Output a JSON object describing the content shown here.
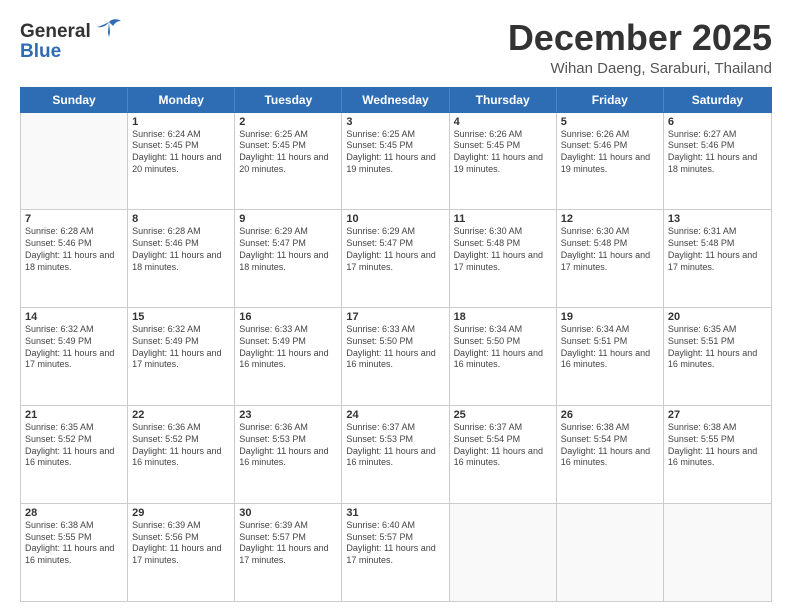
{
  "header": {
    "logo_general": "General",
    "logo_blue": "Blue",
    "month_title": "December 2025",
    "location": "Wihan Daeng, Saraburi, Thailand"
  },
  "days_of_week": [
    "Sunday",
    "Monday",
    "Tuesday",
    "Wednesday",
    "Thursday",
    "Friday",
    "Saturday"
  ],
  "weeks": [
    [
      {
        "day": "",
        "sunrise": "",
        "sunset": "",
        "daylight": ""
      },
      {
        "day": "1",
        "sunrise": "Sunrise: 6:24 AM",
        "sunset": "Sunset: 5:45 PM",
        "daylight": "Daylight: 11 hours and 20 minutes."
      },
      {
        "day": "2",
        "sunrise": "Sunrise: 6:25 AM",
        "sunset": "Sunset: 5:45 PM",
        "daylight": "Daylight: 11 hours and 20 minutes."
      },
      {
        "day": "3",
        "sunrise": "Sunrise: 6:25 AM",
        "sunset": "Sunset: 5:45 PM",
        "daylight": "Daylight: 11 hours and 19 minutes."
      },
      {
        "day": "4",
        "sunrise": "Sunrise: 6:26 AM",
        "sunset": "Sunset: 5:45 PM",
        "daylight": "Daylight: 11 hours and 19 minutes."
      },
      {
        "day": "5",
        "sunrise": "Sunrise: 6:26 AM",
        "sunset": "Sunset: 5:46 PM",
        "daylight": "Daylight: 11 hours and 19 minutes."
      },
      {
        "day": "6",
        "sunrise": "Sunrise: 6:27 AM",
        "sunset": "Sunset: 5:46 PM",
        "daylight": "Daylight: 11 hours and 18 minutes."
      }
    ],
    [
      {
        "day": "7",
        "sunrise": "Sunrise: 6:28 AM",
        "sunset": "Sunset: 5:46 PM",
        "daylight": "Daylight: 11 hours and 18 minutes."
      },
      {
        "day": "8",
        "sunrise": "Sunrise: 6:28 AM",
        "sunset": "Sunset: 5:46 PM",
        "daylight": "Daylight: 11 hours and 18 minutes."
      },
      {
        "day": "9",
        "sunrise": "Sunrise: 6:29 AM",
        "sunset": "Sunset: 5:47 PM",
        "daylight": "Daylight: 11 hours and 18 minutes."
      },
      {
        "day": "10",
        "sunrise": "Sunrise: 6:29 AM",
        "sunset": "Sunset: 5:47 PM",
        "daylight": "Daylight: 11 hours and 17 minutes."
      },
      {
        "day": "11",
        "sunrise": "Sunrise: 6:30 AM",
        "sunset": "Sunset: 5:48 PM",
        "daylight": "Daylight: 11 hours and 17 minutes."
      },
      {
        "day": "12",
        "sunrise": "Sunrise: 6:30 AM",
        "sunset": "Sunset: 5:48 PM",
        "daylight": "Daylight: 11 hours and 17 minutes."
      },
      {
        "day": "13",
        "sunrise": "Sunrise: 6:31 AM",
        "sunset": "Sunset: 5:48 PM",
        "daylight": "Daylight: 11 hours and 17 minutes."
      }
    ],
    [
      {
        "day": "14",
        "sunrise": "Sunrise: 6:32 AM",
        "sunset": "Sunset: 5:49 PM",
        "daylight": "Daylight: 11 hours and 17 minutes."
      },
      {
        "day": "15",
        "sunrise": "Sunrise: 6:32 AM",
        "sunset": "Sunset: 5:49 PM",
        "daylight": "Daylight: 11 hours and 17 minutes."
      },
      {
        "day": "16",
        "sunrise": "Sunrise: 6:33 AM",
        "sunset": "Sunset: 5:49 PM",
        "daylight": "Daylight: 11 hours and 16 minutes."
      },
      {
        "day": "17",
        "sunrise": "Sunrise: 6:33 AM",
        "sunset": "Sunset: 5:50 PM",
        "daylight": "Daylight: 11 hours and 16 minutes."
      },
      {
        "day": "18",
        "sunrise": "Sunrise: 6:34 AM",
        "sunset": "Sunset: 5:50 PM",
        "daylight": "Daylight: 11 hours and 16 minutes."
      },
      {
        "day": "19",
        "sunrise": "Sunrise: 6:34 AM",
        "sunset": "Sunset: 5:51 PM",
        "daylight": "Daylight: 11 hours and 16 minutes."
      },
      {
        "day": "20",
        "sunrise": "Sunrise: 6:35 AM",
        "sunset": "Sunset: 5:51 PM",
        "daylight": "Daylight: 11 hours and 16 minutes."
      }
    ],
    [
      {
        "day": "21",
        "sunrise": "Sunrise: 6:35 AM",
        "sunset": "Sunset: 5:52 PM",
        "daylight": "Daylight: 11 hours and 16 minutes."
      },
      {
        "day": "22",
        "sunrise": "Sunrise: 6:36 AM",
        "sunset": "Sunset: 5:52 PM",
        "daylight": "Daylight: 11 hours and 16 minutes."
      },
      {
        "day": "23",
        "sunrise": "Sunrise: 6:36 AM",
        "sunset": "Sunset: 5:53 PM",
        "daylight": "Daylight: 11 hours and 16 minutes."
      },
      {
        "day": "24",
        "sunrise": "Sunrise: 6:37 AM",
        "sunset": "Sunset: 5:53 PM",
        "daylight": "Daylight: 11 hours and 16 minutes."
      },
      {
        "day": "25",
        "sunrise": "Sunrise: 6:37 AM",
        "sunset": "Sunset: 5:54 PM",
        "daylight": "Daylight: 11 hours and 16 minutes."
      },
      {
        "day": "26",
        "sunrise": "Sunrise: 6:38 AM",
        "sunset": "Sunset: 5:54 PM",
        "daylight": "Daylight: 11 hours and 16 minutes."
      },
      {
        "day": "27",
        "sunrise": "Sunrise: 6:38 AM",
        "sunset": "Sunset: 5:55 PM",
        "daylight": "Daylight: 11 hours and 16 minutes."
      }
    ],
    [
      {
        "day": "28",
        "sunrise": "Sunrise: 6:38 AM",
        "sunset": "Sunset: 5:55 PM",
        "daylight": "Daylight: 11 hours and 16 minutes."
      },
      {
        "day": "29",
        "sunrise": "Sunrise: 6:39 AM",
        "sunset": "Sunset: 5:56 PM",
        "daylight": "Daylight: 11 hours and 17 minutes."
      },
      {
        "day": "30",
        "sunrise": "Sunrise: 6:39 AM",
        "sunset": "Sunset: 5:57 PM",
        "daylight": "Daylight: 11 hours and 17 minutes."
      },
      {
        "day": "31",
        "sunrise": "Sunrise: 6:40 AM",
        "sunset": "Sunset: 5:57 PM",
        "daylight": "Daylight: 11 hours and 17 minutes."
      },
      {
        "day": "",
        "sunrise": "",
        "sunset": "",
        "daylight": ""
      },
      {
        "day": "",
        "sunrise": "",
        "sunset": "",
        "daylight": ""
      },
      {
        "day": "",
        "sunrise": "",
        "sunset": "",
        "daylight": ""
      }
    ]
  ]
}
